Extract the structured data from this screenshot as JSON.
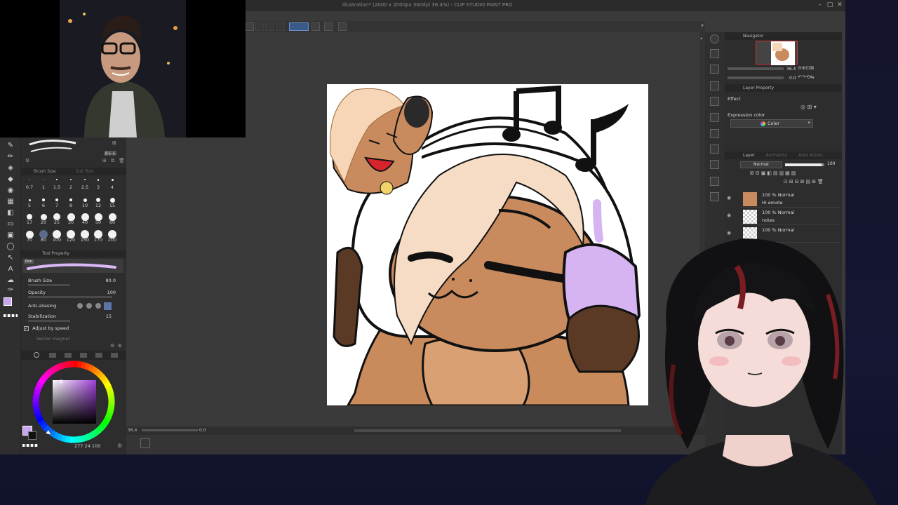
{
  "window": {
    "title": "Illustration* (2000 x 2000px 300dpi 36.4%)  - CLIP STUDIO PAINT PRO",
    "minimize": "–",
    "maximize": "□",
    "close": "✕"
  },
  "brush_panel": {
    "tab_brush_size": "Brush Size",
    "tab_sub_tool": "Sub Tool",
    "small_label": "濃影影",
    "sizes_row1": [
      "0.7",
      "1",
      "1.5",
      "2",
      "2.5",
      "3",
      "4"
    ],
    "sizes_row2": [
      "5",
      "6",
      "7",
      "8",
      "10",
      "12",
      "15"
    ],
    "sizes_row3": [
      "17",
      "20",
      "25",
      "30",
      "40",
      "50",
      "60"
    ],
    "sizes_row4": [
      "70",
      "80",
      "100",
      "120",
      "150",
      "170",
      "200"
    ]
  },
  "tool_property": {
    "header": "Tool Property",
    "preview_label": "Pen",
    "brush_size_label": "Brush Size",
    "brush_size_value": "80.0",
    "opacity_label": "Opacity",
    "opacity_value": "100",
    "antialias_label": "Anti-aliasing",
    "stabilization_label": "Stabilization",
    "stabilization_value": "15",
    "adjust_speed_label": "Adjust by speed",
    "vector_magnet_label": "Vector magnet"
  },
  "color": {
    "readout": "277 24 100",
    "main_color": "#c8a6f2"
  },
  "navigator": {
    "header": "Navigator",
    "zoom": "36.4",
    "rotation": "0.0"
  },
  "layer_property": {
    "header": "Layer Property",
    "effect_label": "Effect",
    "expression_label": "Expression color",
    "expression_value": "Color"
  },
  "layer_panel": {
    "header_tabs": [
      "Layer",
      "Animation",
      "Auto Action"
    ],
    "blend_mode": "Normal",
    "opacity": "100",
    "layers": [
      {
        "mode": "100 % Normal",
        "name": "Hi emote"
      },
      {
        "mode": "100 % Normal",
        "name": "notes"
      },
      {
        "mode": "100 % Normal",
        "name": ""
      }
    ]
  },
  "status": {
    "zoom": "36.4",
    "rotation": "0.0"
  }
}
